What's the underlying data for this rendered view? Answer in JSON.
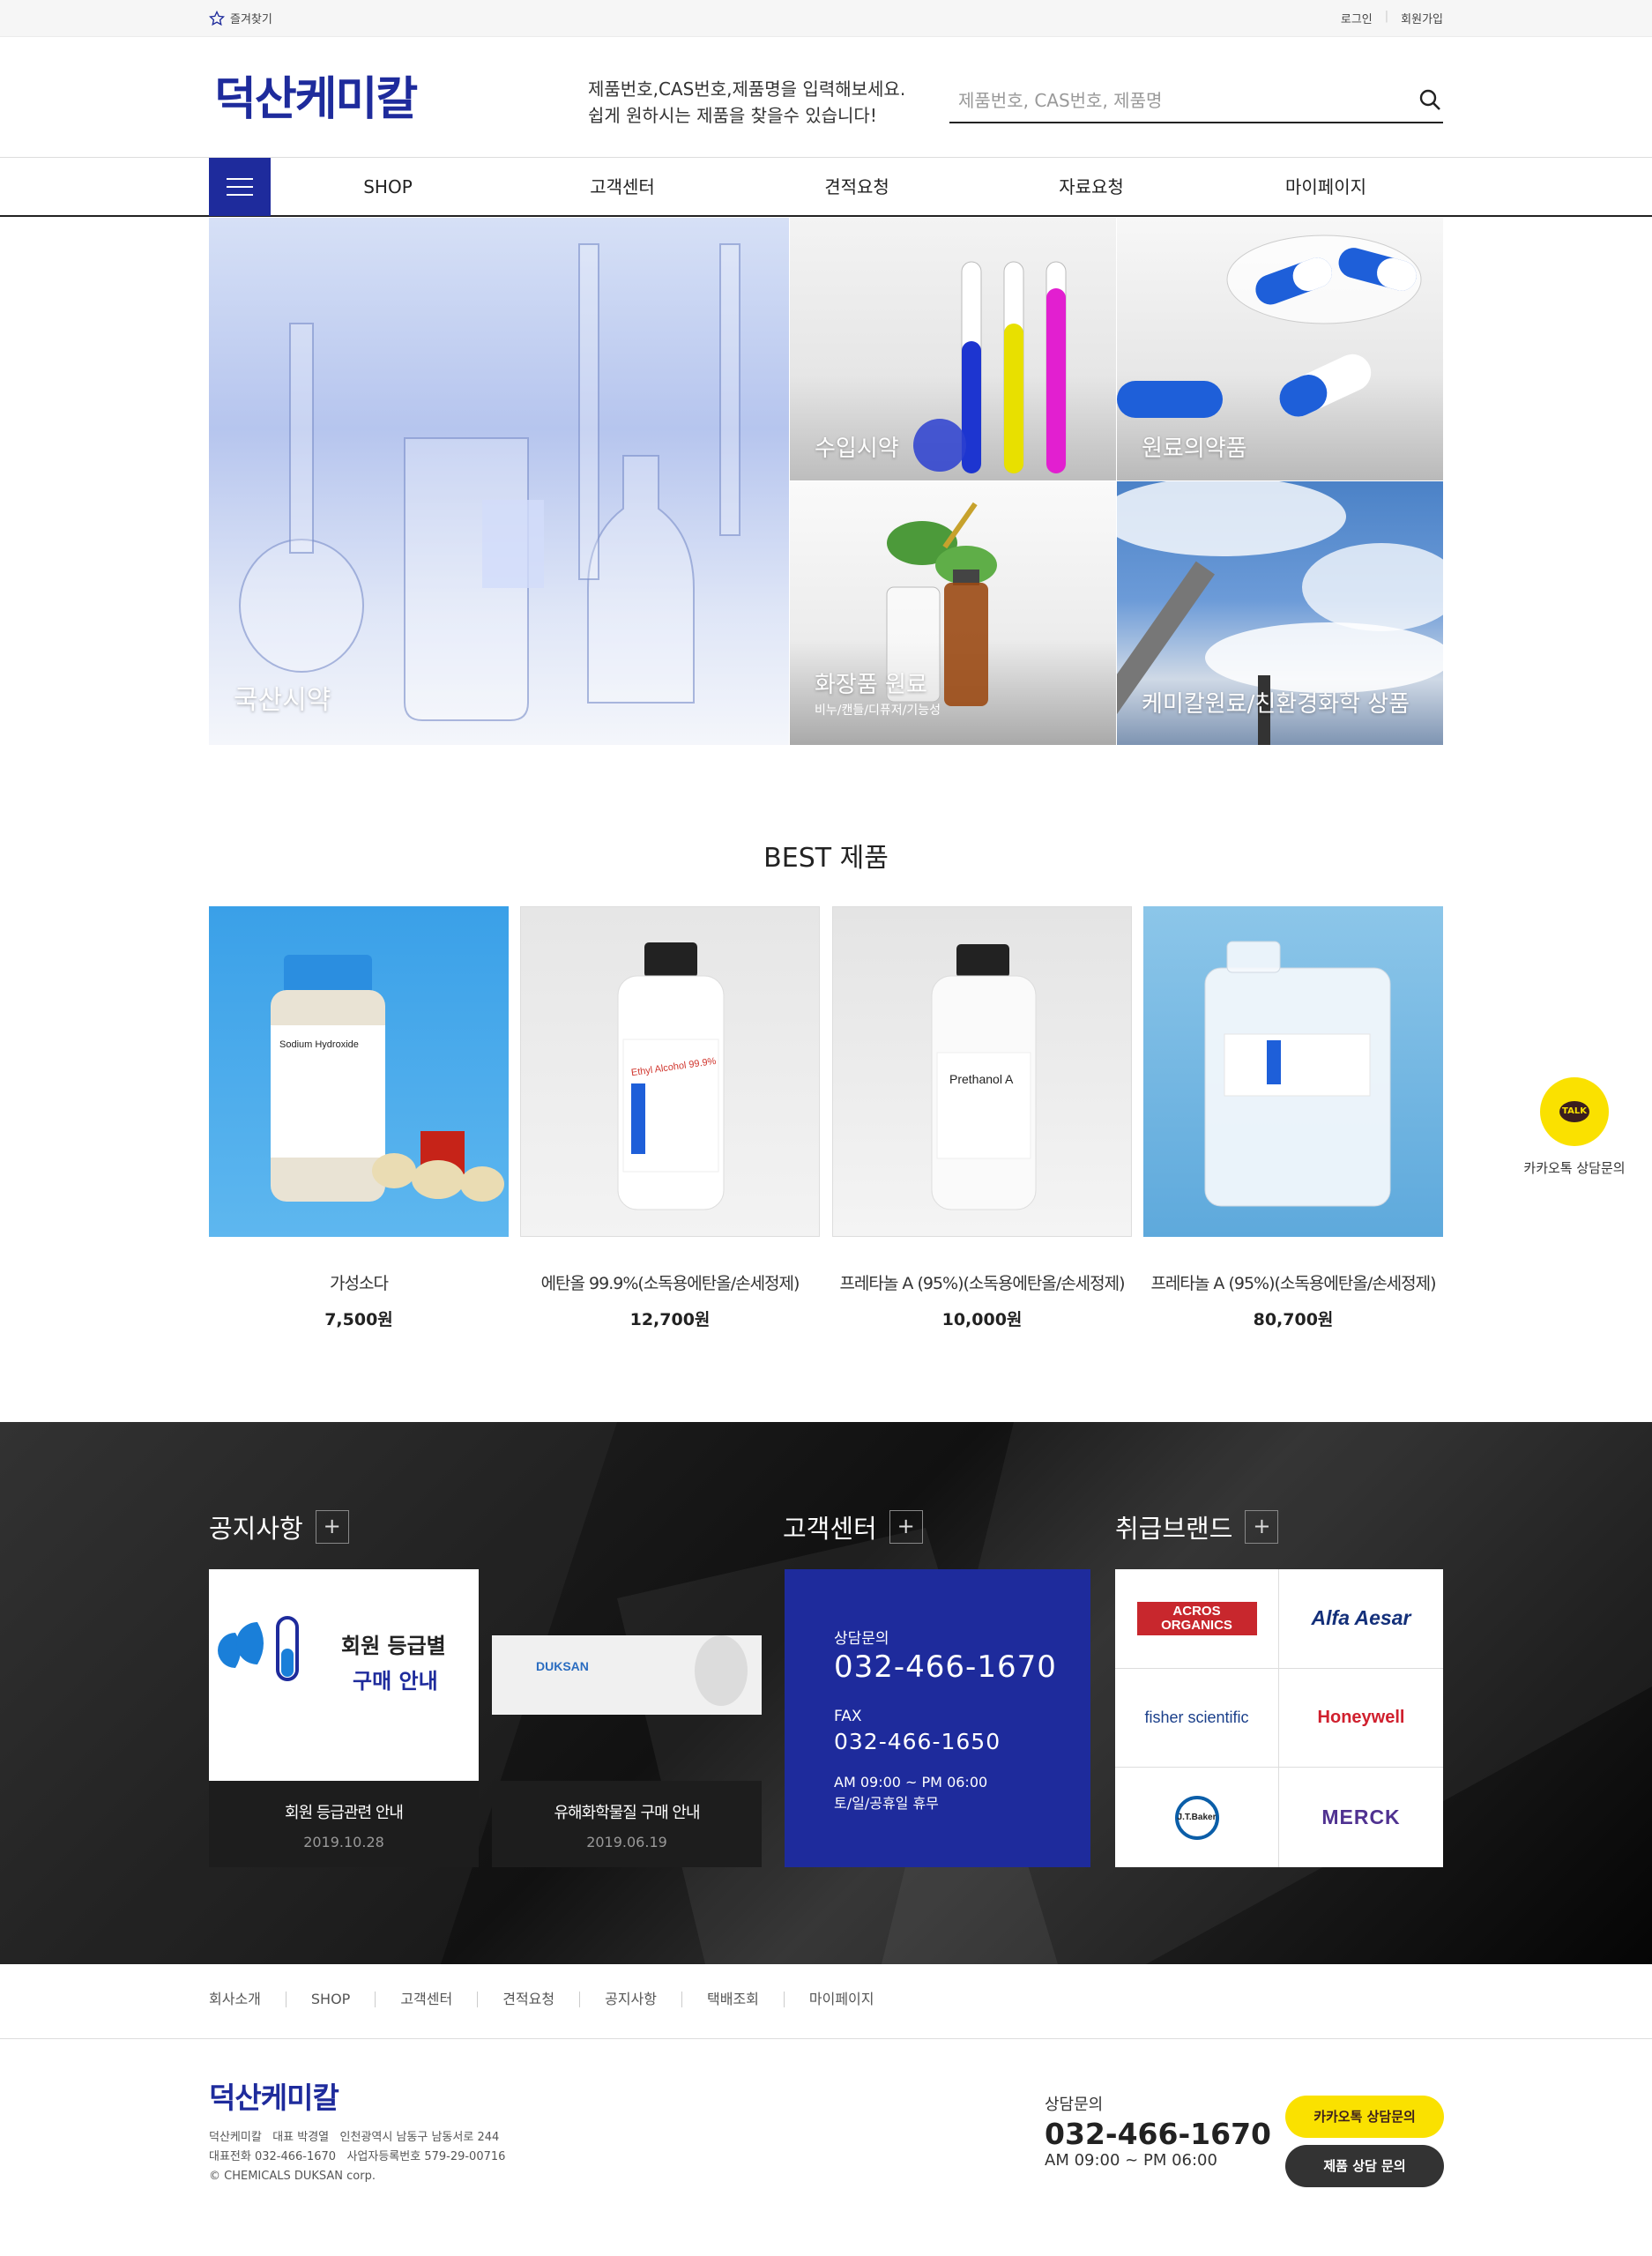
{
  "topbar": {
    "favorite": "즐겨찾기",
    "login": "로그인",
    "join": "회원가입"
  },
  "header": {
    "logo": "덕산케미칼",
    "msg1": "제품번호,CAS번호,제품명을 입력해보세요.",
    "msg2": "쉽게 원하시는 제품을 찾을수 있습니다!",
    "search_placeholder": "제품번호, CAS번호, 제품명"
  },
  "nav": {
    "items": [
      "SHOP",
      "고객센터",
      "견적요청",
      "자료요청",
      "마이페이지"
    ]
  },
  "hero": {
    "main": "국산시약",
    "t1": "수입시약",
    "t2": "원료의약품",
    "t3": "화장품 원료",
    "t3_sub": "비누/캔들/디퓨저/기능성",
    "t4": "케미칼원료/친환경화학 상품"
  },
  "best": {
    "title": "BEST 제품",
    "products": [
      {
        "name": "가성소다",
        "price": "7,500원",
        "label": "Sodium Hydroxide"
      },
      {
        "name": "에탄올 99.9%(소독용에탄올/손세정제)",
        "price": "12,700원",
        "label": "Ethyl Alcohol 99.9%"
      },
      {
        "name": "프레타놀 A (95%)(소독용에탄올/손세정제)",
        "price": "10,000원",
        "label": "Prethanol A"
      },
      {
        "name": "프레타놀 A (95%)(소독용에탄올/손세정제)",
        "price": "80,700원",
        "label": ""
      }
    ]
  },
  "kakao_float": {
    "badge": "TALK",
    "label": "카카오톡 상담문의"
  },
  "notice": {
    "title": "공지사항",
    "items": [
      {
        "title": "회원 등급관련 안내",
        "date": "2019.10.28",
        "img_line1": "회원 등급별",
        "img_line2": "구매 안내"
      },
      {
        "title": "유해화학물질 구매 안내",
        "date": "2019.06.19",
        "img_text": "DUKSAN"
      }
    ]
  },
  "cs": {
    "title": "고객센터",
    "label1": "상담문의",
    "phone": "032-466-1670",
    "label2": "FAX",
    "fax": "032-466-1650",
    "hours": "AM 09:00 ~ PM 06:00",
    "closed": "토/일/공휴일 휴무"
  },
  "brands": {
    "title": "취급브랜드",
    "items": [
      "ACROS ORGANICS",
      "Alfa Aesar",
      "fisher scientific",
      "Honeywell",
      "J.T.Baker",
      "MERCK"
    ]
  },
  "footer": {
    "links": [
      "회사소개",
      "SHOP",
      "고객센터",
      "견적요청",
      "공지사항",
      "택배조회",
      "마이페이지"
    ],
    "logo": "덕산케미칼",
    "info1": "덕산케미칼   대표 박경열   인천광역시 남동구 남동서로 244",
    "info2": "대표전화 032-466-1670   사업자등록번호 579-29-00716",
    "info3": "© CHEMICALS DUKSAN corp.",
    "cs_title": "상담문의",
    "cs_phone": "032-466-1670",
    "cs_hours": "AM 09:00 ~ PM 06:00",
    "btn_kakao": "카카오톡 상담문의",
    "btn_product": "제품 상담 문의"
  },
  "colors": {
    "brand": "#1e2b9c",
    "kakao": "#fae100"
  }
}
